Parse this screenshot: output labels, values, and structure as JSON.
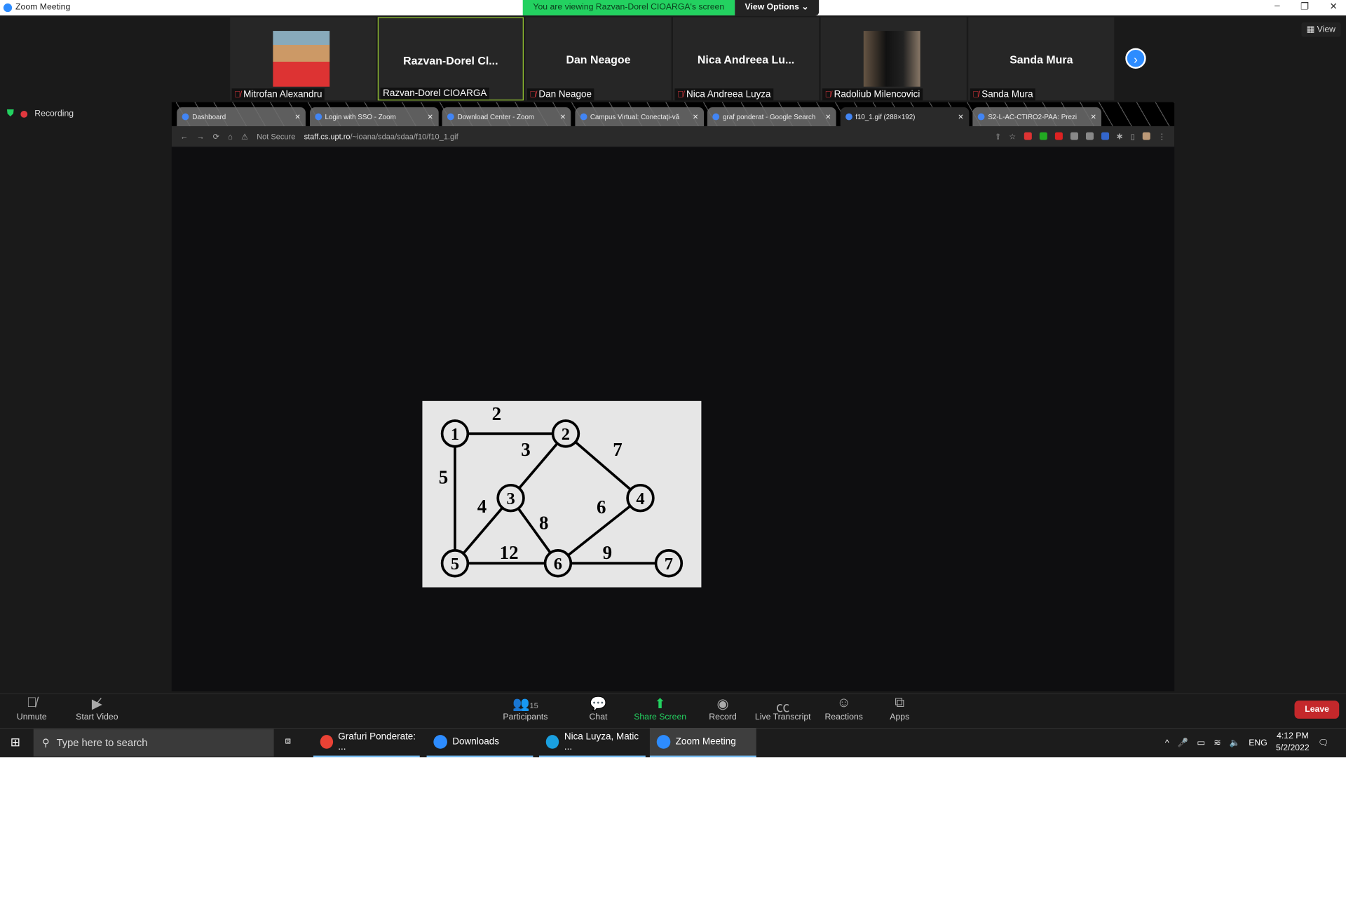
{
  "window": {
    "title": "Zoom Meeting",
    "banner": "You are viewing Razvan-Dorel CIOARGA's screen",
    "view_options": "View Options ⌄",
    "min": "–",
    "max": "❐",
    "close": "✕"
  },
  "participants": [
    {
      "name": "Mitrofan Alexandru",
      "display": "",
      "video": true
    },
    {
      "name": "Razvan-Dorel CIOARGA",
      "display": "Razvan-Dorel  Cl...",
      "video": false
    },
    {
      "name": "Dan Neagoe",
      "display": "Dan Neagoe",
      "video": false
    },
    {
      "name": "Nica Andreea Luyza",
      "display": "Nica Andreea Lu...",
      "video": false
    },
    {
      "name": "Radoliub Milencovici",
      "display": "",
      "video": true
    },
    {
      "name": "Sanda Mura",
      "display": "Sanda Mura",
      "video": false
    }
  ],
  "view_label": "View",
  "recording": "Recording",
  "browser": {
    "tabs": [
      "Dashboard",
      "Login with SSO - Zoom",
      "Download Center - Zoom",
      "Campus Virtual: Conectați-vă",
      "graf ponderat - Google Search",
      "f10_1.gif (288×192)",
      "S2-L-AC-CTIRO2-PAA: Prezi"
    ],
    "not_secure": "Not Secure",
    "url_host": "staff.cs.upt.ro",
    "url_path": "/~ioana/sdaa/sdaa/f10/f10_1.gif"
  },
  "graph": {
    "nodes": [
      "1",
      "2",
      "3",
      "4",
      "5",
      "6",
      "7"
    ],
    "edges": [
      {
        "from": "1",
        "to": "2",
        "w": "2"
      },
      {
        "from": "2",
        "to": "3",
        "w": "3"
      },
      {
        "from": "2",
        "to": "4",
        "w": "7"
      },
      {
        "from": "1",
        "to": "5",
        "w": "5"
      },
      {
        "from": "3",
        "to": "5",
        "w": "4"
      },
      {
        "from": "3",
        "to": "6",
        "w": "8"
      },
      {
        "from": "4",
        "to": "6",
        "w": "6"
      },
      {
        "from": "5",
        "to": "6",
        "w": "12"
      },
      {
        "from": "6",
        "to": "7",
        "w": "9"
      }
    ]
  },
  "toolbar": {
    "unmute": "Unmute",
    "start_video": "Start Video",
    "participants": "Participants",
    "participant_count": "15",
    "chat": "Chat",
    "share": "Share Screen",
    "record": "Record",
    "transcript": "Live Transcript",
    "reactions": "Reactions",
    "apps": "Apps",
    "leave": "Leave"
  },
  "taskbar": {
    "search_placeholder": "Type here to search",
    "apps": [
      "Grafuri Ponderate: ...",
      "Downloads",
      "Nica Luyza, Matic ...",
      "Zoom Meeting"
    ],
    "lang": "ENG",
    "time": "4:12 PM",
    "date": "5/2/2022"
  }
}
